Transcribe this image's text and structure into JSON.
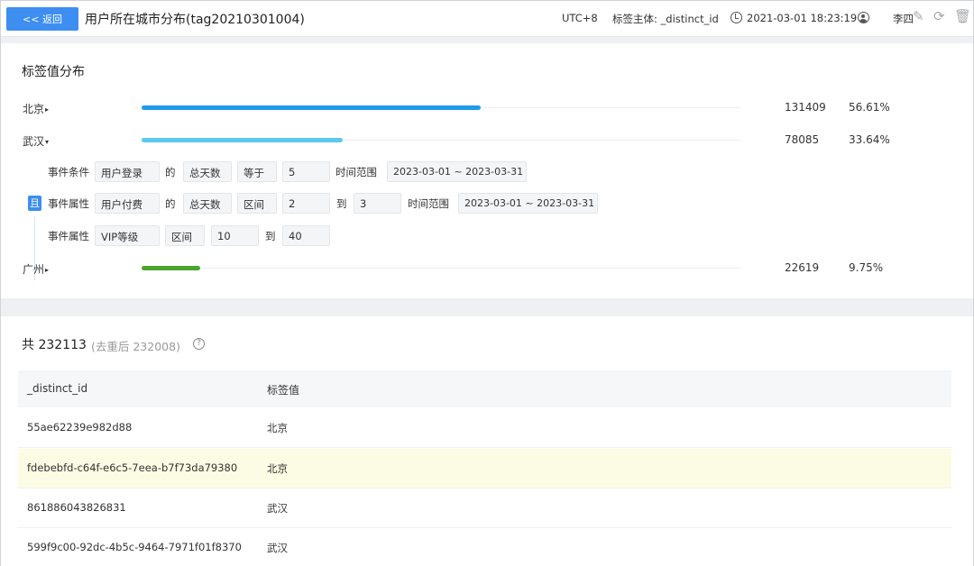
{
  "header": {
    "back_label": "<< 返回",
    "title": "用户所在城市分布(tag20210301004)",
    "timezone": "UTC+8",
    "subject": "标签主体: _distinct_id",
    "datetime": "2021-03-01 18:23:19",
    "user": "李四",
    "icons": [
      "clock-icon",
      "user-icon",
      "edit-icon",
      "refresh-icon",
      "delete-icon"
    ]
  },
  "distribution": {
    "title": "标签值分布",
    "rows": [
      {
        "city": "北京",
        "arrow": "▸",
        "count": "131409",
        "percent": "56.61%",
        "fraction": 0.5661,
        "color": "#1e9be8"
      },
      {
        "city": "武汉",
        "arrow": "▾",
        "count": "78085",
        "percent": "33.64%",
        "fraction": 0.3364,
        "color": "#5bc8f0"
      },
      {
        "city": "广州",
        "arrow": "▸",
        "count": "22619",
        "percent": "9.75%",
        "fraction": 0.0975,
        "color": "#4aa52b"
      }
    ],
    "conditions": {
      "and_label": "且",
      "row1": {
        "label": "事件条件",
        "event": "用户登录",
        "of": "的",
        "metric": "总天数",
        "op": "等于",
        "value": "5",
        "range_label": "时间范围",
        "range": "2023-03-01 ~ 2023-03-31"
      },
      "row2": {
        "label": "事件属性",
        "event": "用户付费",
        "of": "的",
        "metric": "总天数",
        "op": "区间",
        "from": "2",
        "to_label": "到",
        "to": "3",
        "range_label": "时间范围",
        "range": "2023-03-01 ~ 2023-03-31"
      },
      "row3": {
        "label": "事件属性",
        "prop": "VIP等级",
        "op": "区间",
        "from": "10",
        "to_label": "到",
        "to": "40"
      }
    }
  },
  "table": {
    "total": "共 232113",
    "dedup": "(去重后 232008)",
    "help": "?",
    "columns": [
      "_distinct_id",
      "标签值"
    ],
    "rows": [
      {
        "id": "55ae62239e982d88",
        "value": "北京"
      },
      {
        "id": "fdebebfd-c64f-e6c5-7eea-b7f73da79380",
        "value": "北京"
      },
      {
        "id": "861886043826831",
        "value": "武汉"
      },
      {
        "id": "599f9c00-92dc-4b5c-9464-7971f01f8370",
        "value": "武汉"
      }
    ]
  }
}
